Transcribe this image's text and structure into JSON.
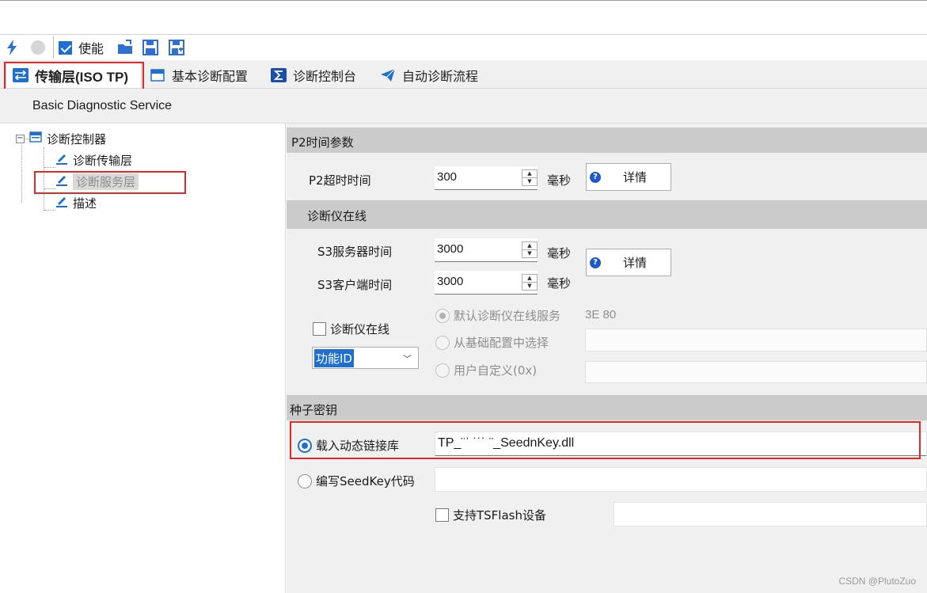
{
  "toolbar": {
    "enable_label": "使能"
  },
  "tabs": [
    {
      "label": "传输层(ISO TP)"
    },
    {
      "label": "基本诊断配置"
    },
    {
      "label": "诊断控制台"
    },
    {
      "label": "自动诊断流程"
    }
  ],
  "subheader": "Basic Diagnostic Service",
  "tree": {
    "root": "诊断控制器",
    "children": [
      "诊断传输层",
      "诊断服务层",
      "描述"
    ]
  },
  "p2": {
    "section": "P2时间参数",
    "timeout_label": "P2超时时间",
    "timeout_value": "300",
    "unit": "毫秒",
    "details": "详情"
  },
  "tester": {
    "section": "诊断仪在线",
    "s3_server_label": "S3服务器时间",
    "s3_server_value": "3000",
    "s3_client_label": "S3客户端时间",
    "s3_client_value": "3000",
    "unit": "毫秒",
    "details": "详情",
    "online_checkbox": "诊断仪在线",
    "func_id": "功能ID",
    "opt_default": "默认诊断仪在线服务",
    "opt_default_value": "3E 80",
    "opt_base": "从基础配置中选择",
    "opt_custom": "用户自定义(0x)"
  },
  "seed": {
    "section": "种子密钥",
    "opt_dll": "载入动态链接库",
    "dll_value": "TP_¨ˈ ˙˙˙ ¨_SeednKey.dll",
    "opt_code": "编写SeedKey代码",
    "tsflash": "支持TSFlash设备"
  },
  "watermark": "CSDN @PlutoZuo",
  "colors": {
    "accent": "#1e6fd0",
    "highlight": "#e02a2a"
  }
}
